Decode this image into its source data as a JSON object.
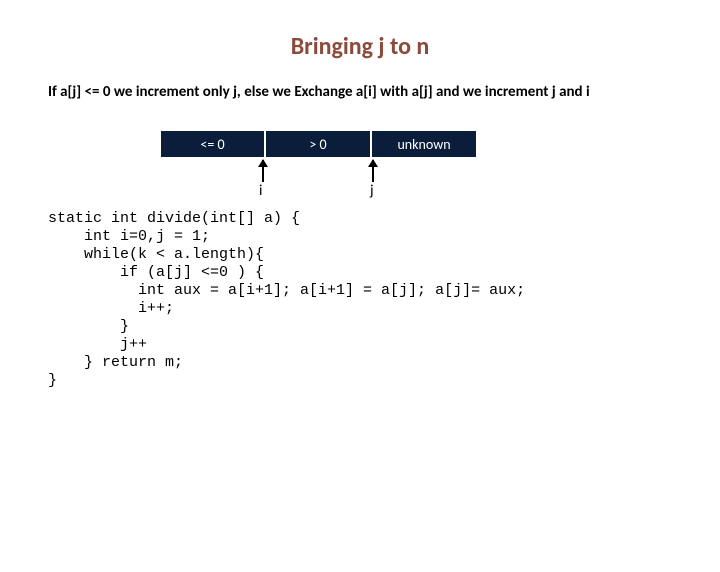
{
  "title": "Bringing j to n",
  "description": "If a[j]  <= 0 we increment only j, else we Exchange a[i] with a[j] and we increment j and i",
  "cells": {
    "c0": "<= 0",
    "c1": "> 0",
    "c2": "unknown"
  },
  "labels": {
    "i": "i",
    "j": "j"
  },
  "code": {
    "l1": "static int divide(int[] a) {",
    "l2": "    int i=0,j = 1;",
    "l3": "    while(k < a.length){",
    "l4": "        if (a[j] <=0 ) {",
    "l5": "          int aux = a[i+1]; a[i+1] = a[j]; a[j]= aux;",
    "l6": "          i++;",
    "l7": "        }",
    "l8": "        j++",
    "l9": "    } return m;",
    "l10": "}"
  }
}
